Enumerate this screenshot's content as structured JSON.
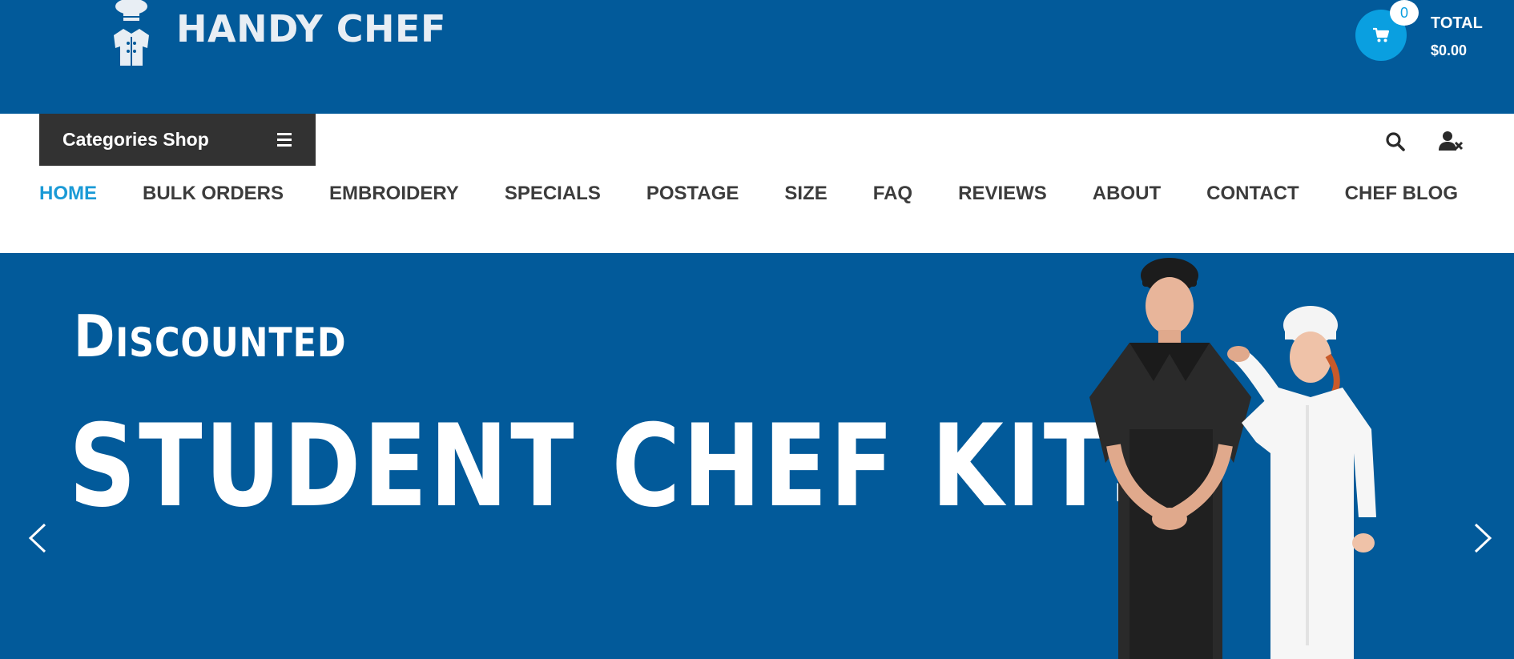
{
  "header": {
    "logo_text": "HANDY CHEF",
    "cart": {
      "count": "0",
      "total_label": "TOTAL",
      "total_value": "$0.00"
    }
  },
  "nav": {
    "categories_label": "Categories Shop",
    "menu": [
      {
        "label": "HOME",
        "active": true
      },
      {
        "label": "BULK ORDERS"
      },
      {
        "label": "EMBROIDERY"
      },
      {
        "label": "SPECIALS"
      },
      {
        "label": "POSTAGE"
      },
      {
        "label": "SIZE"
      },
      {
        "label": "FAQ"
      },
      {
        "label": "REVIEWS"
      },
      {
        "label": "ABOUT"
      },
      {
        "label": "CONTACT"
      },
      {
        "label": "CHEF BLOG"
      }
    ]
  },
  "hero": {
    "line1": "Discounted",
    "line2": "STUDENT CHEF KITS"
  },
  "colors": {
    "brand_blue": "#025a9a",
    "accent": "#0a9fe0",
    "active_menu": "#1a9ad6",
    "dark_bar": "#323232"
  },
  "icons": [
    "chef-logo-icon",
    "cart-icon",
    "menu-icon",
    "search-icon",
    "user-x-icon",
    "chevron-left-icon",
    "chevron-right-icon"
  ]
}
